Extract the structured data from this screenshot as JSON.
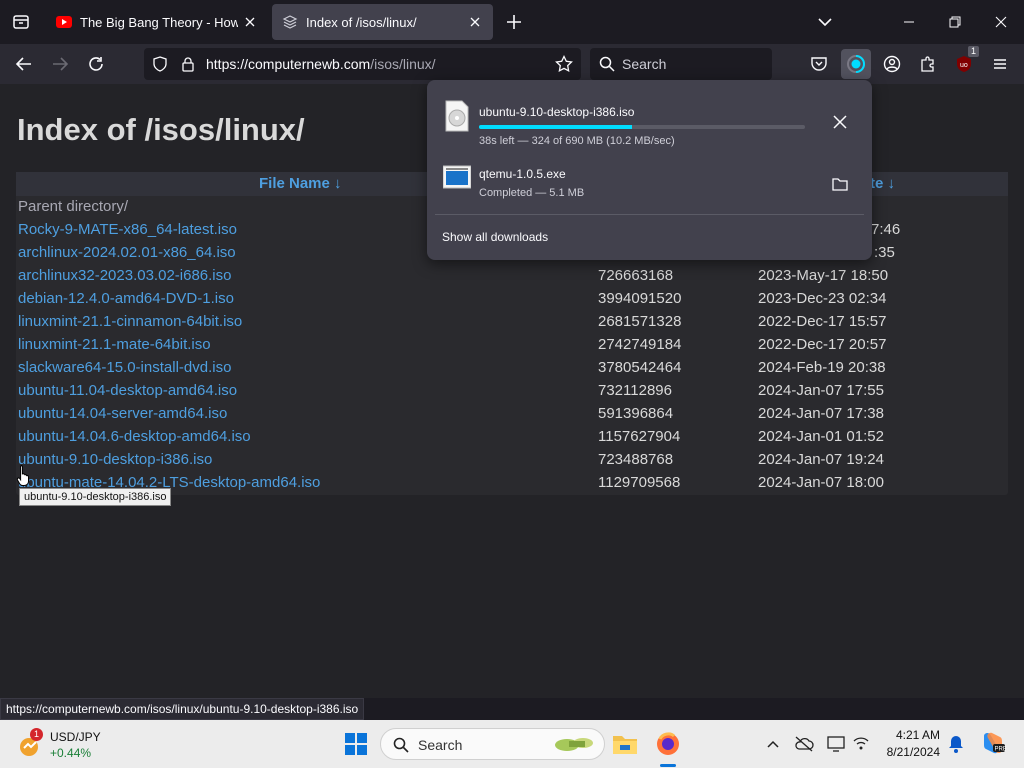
{
  "browser": {
    "tabs": [
      {
        "title": "The Big Bang Theory - Howard",
        "active": false
      },
      {
        "title": "Index of /isos/linux/",
        "active": true
      }
    ],
    "url": {
      "base": "https://computernewb.com",
      "path": "/isos/linux/"
    },
    "search_placeholder": "Search",
    "ublock_badge": "1"
  },
  "page": {
    "title": "Index of /isos/linux/",
    "headers": {
      "name": "File Name  ↓",
      "date": "te  ↓"
    },
    "parent": "Parent directory/",
    "rows": [
      {
        "name": "Rocky-9-MATE-x86_64-latest.iso",
        "size": "",
        "date": "7:46"
      },
      {
        "name": "archlinux-2024.02.01-x86_64.iso",
        "size": "",
        "date": ":35"
      },
      {
        "name": "archlinux32-2023.03.02-i686.iso",
        "size": "726663168",
        "date": "2023-May-17 18:50"
      },
      {
        "name": "debian-12.4.0-amd64-DVD-1.iso",
        "size": "3994091520",
        "date": "2023-Dec-23 02:34"
      },
      {
        "name": "linuxmint-21.1-cinnamon-64bit.iso",
        "size": "2681571328",
        "date": "2022-Dec-17 15:57"
      },
      {
        "name": "linuxmint-21.1-mate-64bit.iso",
        "size": "2742749184",
        "date": "2022-Dec-17 20:57"
      },
      {
        "name": "slackware64-15.0-install-dvd.iso",
        "size": "3780542464",
        "date": "2024-Feb-19 20:38"
      },
      {
        "name": "ubuntu-11.04-desktop-amd64.iso",
        "size": "732112896",
        "date": "2024-Jan-07 17:55"
      },
      {
        "name": "ubuntu-14.04-server-amd64.iso",
        "size": "591396864",
        "date": "2024-Jan-07 17:38"
      },
      {
        "name": "ubuntu-14.04.6-desktop-amd64.iso",
        "size": "1157627904",
        "date": "2024-Jan-01 01:52"
      },
      {
        "name": "ubuntu-9.10-desktop-i386.iso",
        "size": "723488768",
        "date": "2024-Jan-07 19:24"
      },
      {
        "name": "ubuntu-mate-14.04.2-LTS-desktop-amd64.iso",
        "size": "1129709568",
        "date": "2024-Jan-07 18:00"
      }
    ],
    "tooltip": "ubuntu-9.10-desktop-i386.iso"
  },
  "downloads": {
    "items": [
      {
        "name": "ubuntu-9.10-desktop-i386.iso",
        "status": "38s left — 324 of 690 MB (10.2 MB/sec)",
        "progress": 0.47
      },
      {
        "name": "qtemu-1.0.5.exe",
        "status": "Completed — 5.1 MB"
      }
    ],
    "show_all": "Show all downloads"
  },
  "statusbar": "https://computernewb.com/isos/linux/ubuntu-9.10-desktop-i386.iso",
  "taskbar": {
    "ticker": "USD/JPY",
    "ticker_change": "+0.44%",
    "ticker_badge": "1",
    "search": "Search",
    "time": "4:21 AM",
    "date": "8/21/2024"
  },
  "colors": {
    "link": "#4e9fe0",
    "progress": "#00ddff",
    "active_tab": "#42414d"
  }
}
